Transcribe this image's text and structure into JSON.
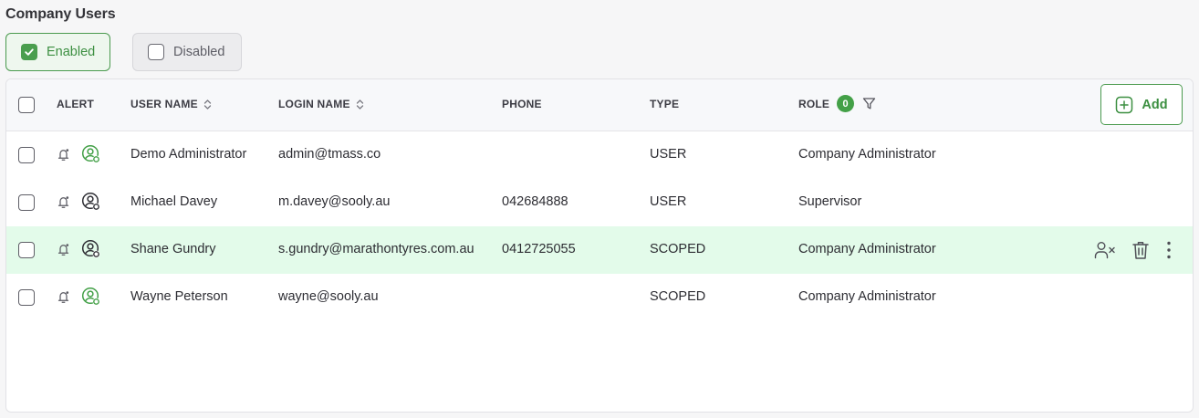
{
  "page": {
    "title": "Company Users"
  },
  "filters": {
    "enabled_label": "Enabled",
    "disabled_label": "Disabled",
    "enabled_checked": true,
    "disabled_checked": false
  },
  "table": {
    "headers": {
      "alert": "ALERT",
      "user_name": "USER NAME",
      "login_name": "LOGIN NAME",
      "phone": "PHONE",
      "type": "TYPE",
      "role": "ROLE"
    },
    "role_filter_count": "0",
    "add_label": "Add",
    "rows": [
      {
        "user_name": "Demo Administrator",
        "login_name": "admin@tmass.co",
        "phone": "",
        "type": "USER",
        "role": "Company Administrator",
        "user_icon_color": "#43a047",
        "highlighted": false
      },
      {
        "user_name": "Michael Davey",
        "login_name": "m.davey@sooly.au",
        "phone": "042684888",
        "type": "USER",
        "role": "Supervisor",
        "user_icon_color": "#2f2f35",
        "highlighted": false
      },
      {
        "user_name": "Shane Gundry",
        "login_name": "s.gundry@marathontyres.com.au",
        "phone": "0412725055",
        "type": "SCOPED",
        "role": "Company Administrator",
        "user_icon_color": "#2f2f35",
        "highlighted": true
      },
      {
        "user_name": "Wayne Peterson",
        "login_name": "wayne@sooly.au",
        "phone": "",
        "type": "SCOPED",
        "role": "Company Administrator",
        "user_icon_color": "#43a047",
        "highlighted": false
      }
    ]
  },
  "colors": {
    "accent": "#43a047",
    "highlight_row": "#e3fbea"
  }
}
